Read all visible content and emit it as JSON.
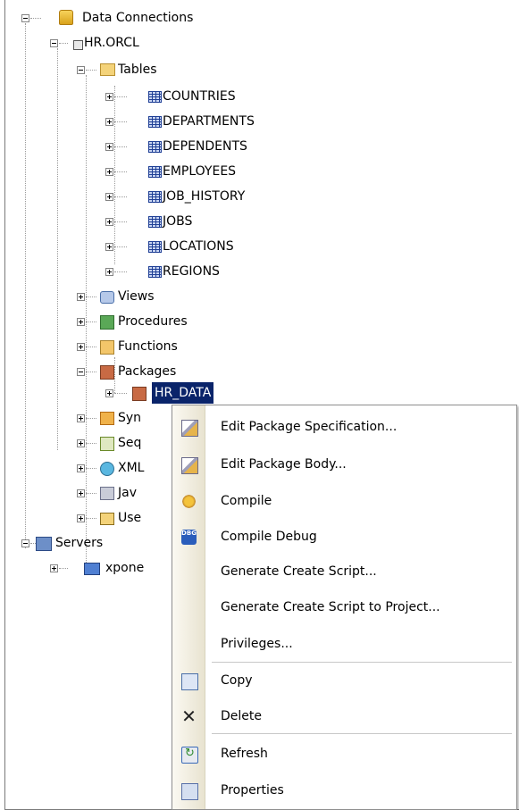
{
  "tree": {
    "data_connections": "Data Connections",
    "connection": "HR.ORCL",
    "tables_folder": "Tables",
    "tables": [
      "COUNTRIES",
      "DEPARTMENTS",
      "DEPENDENTS",
      "EMPLOYEES",
      "JOB_HISTORY",
      "JOBS",
      "LOCATIONS",
      "REGIONS"
    ],
    "views": "Views",
    "procedures": "Procedures",
    "functions": "Functions",
    "packages": "Packages",
    "selected_package": "HR_DATA",
    "synonyms_partial": "Syn",
    "sequences_partial": "Seq",
    "xml_partial": "XML",
    "java_partial": "Jav",
    "user_partial": "Use",
    "servers": "Servers",
    "server_item": "xpone"
  },
  "context_menu": {
    "items": [
      {
        "label": "Edit Package Specification...",
        "icon": "edit-spec-icon"
      },
      {
        "label": "Edit Package Body...",
        "icon": "edit-body-icon"
      },
      {
        "label": "Compile",
        "icon": "compile-icon"
      },
      {
        "label": "Compile Debug",
        "icon": "compile-debug-icon",
        "badge": "DBG"
      },
      {
        "label": "Generate Create Script...",
        "icon": ""
      },
      {
        "label": "Generate Create Script to Project...",
        "icon": ""
      },
      {
        "label": "Privileges...",
        "icon": ""
      },
      {
        "label": "Copy",
        "icon": "copy-icon"
      },
      {
        "label": "Delete",
        "icon": "delete-icon",
        "glyph": "✕"
      },
      {
        "label": "Refresh",
        "icon": "refresh-icon"
      },
      {
        "label": "Properties",
        "icon": "properties-icon"
      }
    ]
  }
}
